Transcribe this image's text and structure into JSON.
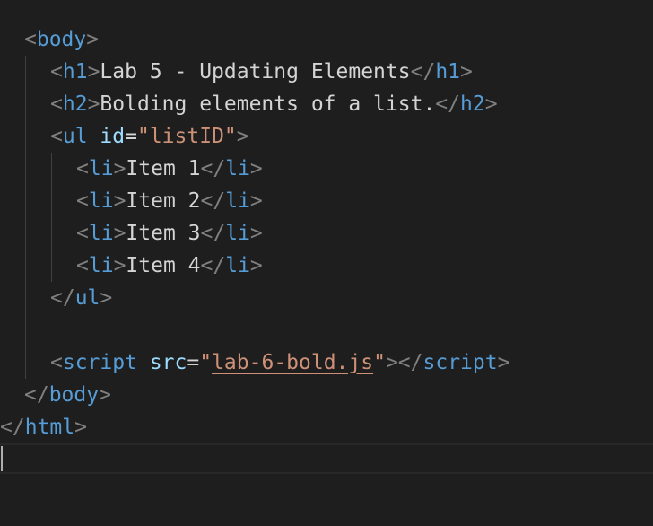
{
  "code": {
    "body_open": "body",
    "h1_tag": "h1",
    "h1_text": "Lab 5 - Updating Elements",
    "h2_tag": "h2",
    "h2_text": "Bolding elements of a list.",
    "ul_tag": "ul",
    "ul_attr": "id",
    "ul_value": "\"listID\"",
    "li_tag": "li",
    "items": [
      "Item 1",
      "Item 2",
      "Item 3",
      "Item 4"
    ],
    "script_tag": "script",
    "script_attr": "src",
    "script_src_quote_open": "\"",
    "script_src": "lab-6-bold.js",
    "script_src_quote_close": "\"",
    "html_tag": "html"
  },
  "colors": {
    "background": "#1e1e1e",
    "tag": "#569cd6",
    "attribute": "#9cdcfe",
    "string": "#ce9178",
    "text": "#d4d4d4",
    "punctuation": "#808080"
  }
}
